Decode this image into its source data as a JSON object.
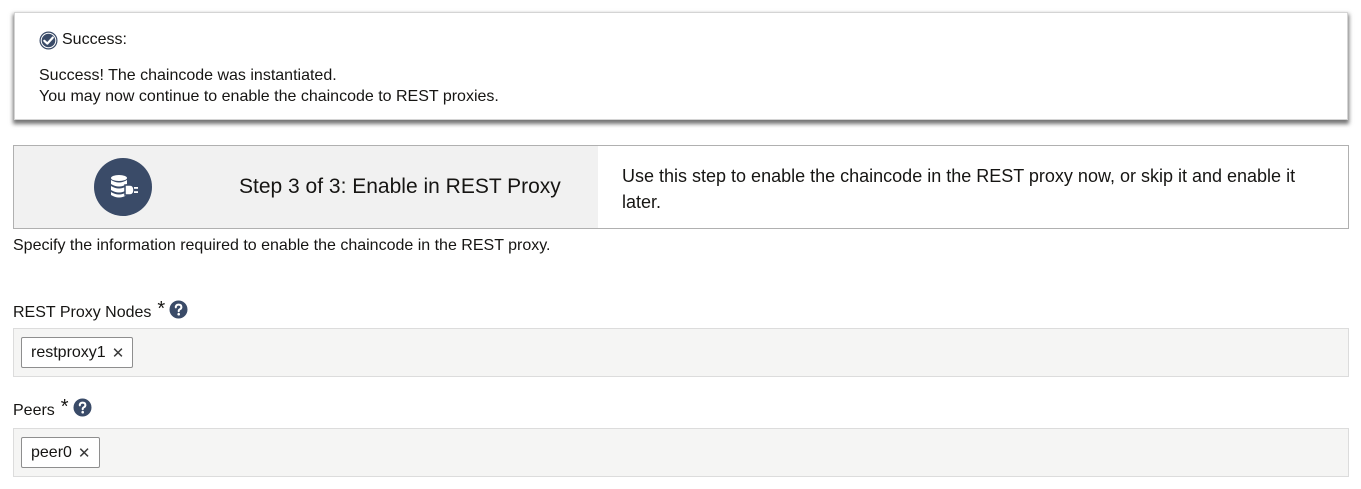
{
  "notification": {
    "icon": "check-circle-icon",
    "title": "Success:",
    "line1": "Success! The chaincode was instantiated.",
    "line2": "You may now continue to enable the chaincode to REST proxies."
  },
  "train": {
    "icon": "rest-proxy-plug-icon",
    "step_title": "Step 3 of 3: Enable in REST Proxy",
    "description": "Use this step to enable the chaincode in the REST proxy now, or skip it and enable it later."
  },
  "instructions": "Specify the information required to enable the chaincode in the REST proxy.",
  "fields": {
    "rest_proxy_nodes": {
      "label": "REST Proxy Nodes",
      "required_mark": "*",
      "help_icon": "question-circle-icon",
      "chips": [
        {
          "label": "restproxy1",
          "remove": "✕"
        }
      ]
    },
    "peers": {
      "label": "Peers",
      "required_mark": "*",
      "help_icon": "question-circle-icon",
      "chips": [
        {
          "label": "peer0",
          "remove": "✕"
        }
      ]
    }
  },
  "colors": {
    "icon_navy": "#3a4b68",
    "text": "#161513",
    "train_bg": "#f1f1f1",
    "field_bg": "#f5f5f4"
  }
}
